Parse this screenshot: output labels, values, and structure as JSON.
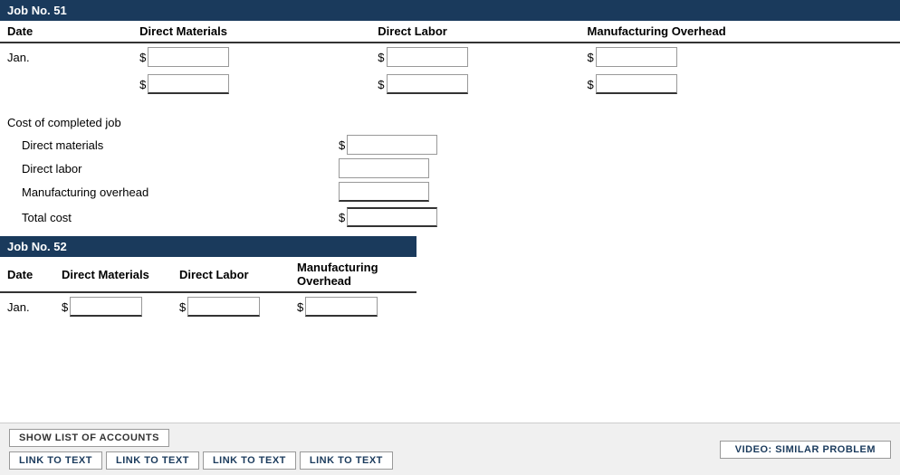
{
  "job1": {
    "title": "Job No. 51",
    "headers": {
      "date": "Date",
      "dm": "Direct Materials",
      "dl": "Direct Labor",
      "mo": "Manufacturing Overhead"
    },
    "row1_date": "Jan.",
    "row2_date": ""
  },
  "cost_summary": {
    "title": "Cost of completed job",
    "dm_label": "Direct materials",
    "dl_label": "Direct labor",
    "mo_label": "Manufacturing overhead",
    "total_label": "Total cost"
  },
  "job2": {
    "title": "Job No. 52",
    "headers": {
      "date": "Date",
      "dm": "Direct Materials",
      "dl": "Direct Labor",
      "mo": "Manufacturing Overhead"
    },
    "row1_date": "Jan."
  },
  "toolbar": {
    "show_accounts_label": "SHOW LIST OF ACCOUNTS",
    "link_btn1": "LINK TO TEXT",
    "link_btn2": "LINK TO TEXT",
    "link_btn3": "LINK TO TEXT",
    "link_btn4": "LINK TO TEXT",
    "video_btn": "VIDEO: SIMILAR PROBLEM"
  }
}
